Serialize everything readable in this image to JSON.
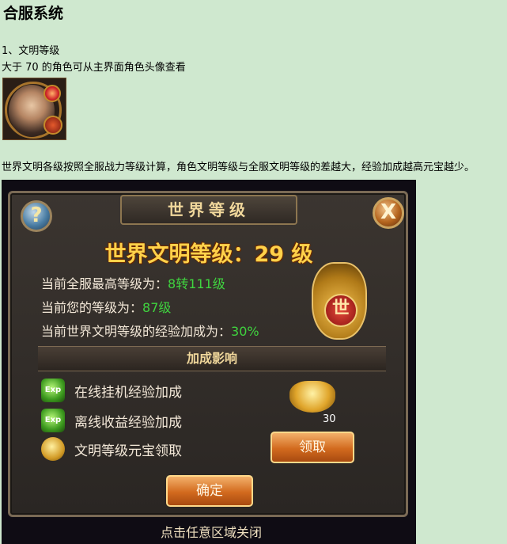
{
  "page": {
    "title": "合服系统",
    "line1": "1、文明等级",
    "line2": "大于 70 的角色可从主界面角色头像查看",
    "line3": "世界文明各级按照全服战力等级计算，角色文明等级与全服文明等级的差越大，经验加成越高元宝越少。"
  },
  "game": {
    "panel_title": "世界等级",
    "world_level_text": "世界文明等级：29 级",
    "info": [
      {
        "label": "当前全服最高等级为：",
        "value": "8转111级"
      },
      {
        "label": "当前您的等级为：",
        "value": "87级"
      },
      {
        "label": "当前世界文明等级的经验加成为：",
        "value": "30%"
      }
    ],
    "section_title": "加成影响",
    "rows": [
      {
        "icon": "exp-icon",
        "label": "在线挂机经验加成"
      },
      {
        "icon": "exp-icon",
        "label": "离线收益经验加成"
      },
      {
        "icon": "gold-ingot-icon",
        "label": "文明等级元宝领取"
      }
    ],
    "ingot_count": "30",
    "claim_label": "领取",
    "confirm_label": "确定",
    "bottom_hint": "点击任意区域关闭",
    "seal_char": "世",
    "help_char": "?",
    "close_char": "X",
    "exp_text": "Exp"
  }
}
